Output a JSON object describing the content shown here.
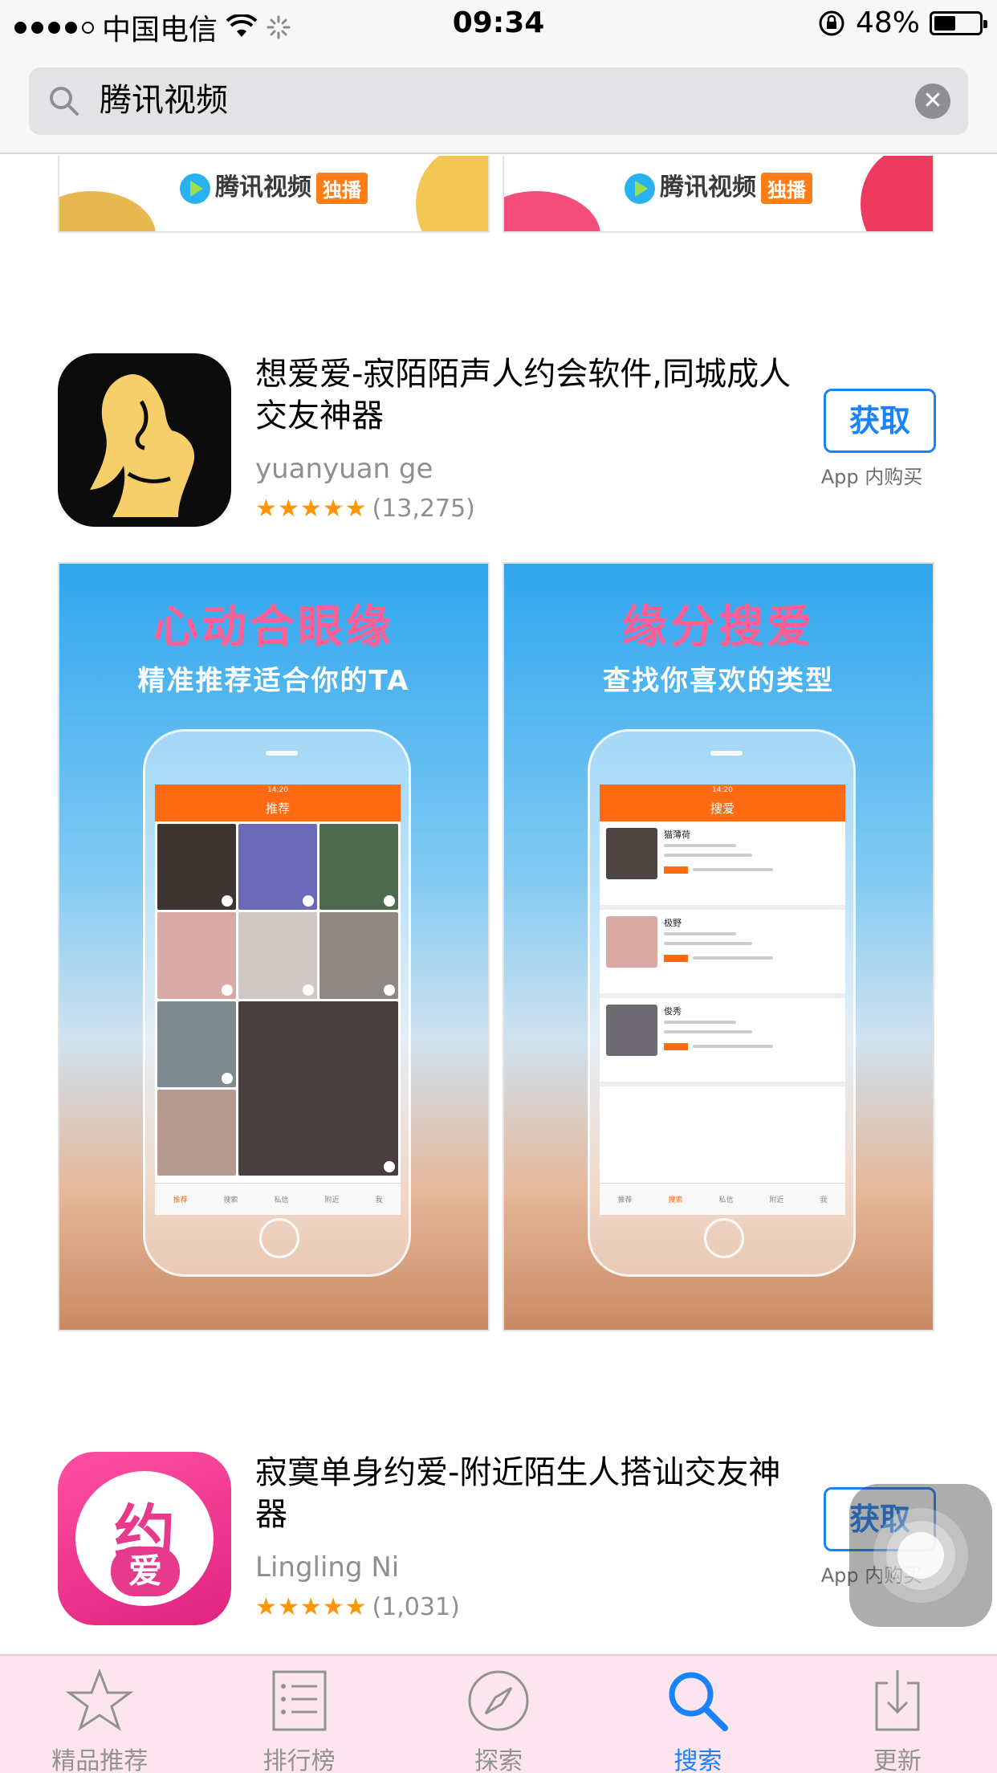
{
  "status_bar": {
    "carrier": "中国电信",
    "time": "09:34",
    "battery": "48%",
    "battery_level": 0.48
  },
  "search": {
    "query": "腾讯视频"
  },
  "prior_banners": [
    {
      "brand": "腾讯视频",
      "tag": "独播"
    },
    {
      "brand": "腾讯视频",
      "tag": "独播"
    }
  ],
  "apps": [
    {
      "title": "想爱爱-寂陌陌声人约会软件,同城成人交友神器",
      "developer": "yuanyuan ge",
      "stars": "★★★★★",
      "rating_count": "(13,275)",
      "rating": 5,
      "get_label": "获取",
      "iap_label": "App 内购买",
      "screenshots": [
        {
          "title": "心动合眼缘",
          "subtitle": "精准推荐适合你的TA",
          "screen_time": "14:20",
          "screen_title": "推荐",
          "tabs": [
            "推荐",
            "搜索",
            "私信",
            "附近",
            "我"
          ]
        },
        {
          "title": "缘分搜爱",
          "subtitle": "查找你喜欢的类型",
          "screen_time": "14:20",
          "screen_title": "搜爱",
          "list_names": [
            "猫薄荷",
            "极野",
            "俊秀"
          ],
          "tabs": [
            "推荐",
            "搜索",
            "私信",
            "附近",
            "我"
          ]
        }
      ]
    },
    {
      "title": "寂寞单身约爱-附近陌生人搭讪交友神器",
      "developer": "Lingling Ni",
      "stars": "★★★★★",
      "rating_count": "(1,031)",
      "rating": 5,
      "get_label": "获取",
      "iap_label": "App 内购买",
      "icon_text_top": "约",
      "icon_text_bottom": "爱"
    }
  ],
  "tab_bar": {
    "items": [
      {
        "label": "精品推荐",
        "icon": "star-icon"
      },
      {
        "label": "排行榜",
        "icon": "list-icon"
      },
      {
        "label": "探索",
        "icon": "compass-icon"
      },
      {
        "label": "搜索",
        "icon": "search-icon",
        "active": true
      },
      {
        "label": "更新",
        "icon": "download-icon"
      }
    ]
  },
  "colors": {
    "accent": "#1a82fb",
    "star": "#ff9500",
    "tab_inactive": "#929292",
    "pink_title": "#ff5f95",
    "orange": "#ff6a13"
  }
}
